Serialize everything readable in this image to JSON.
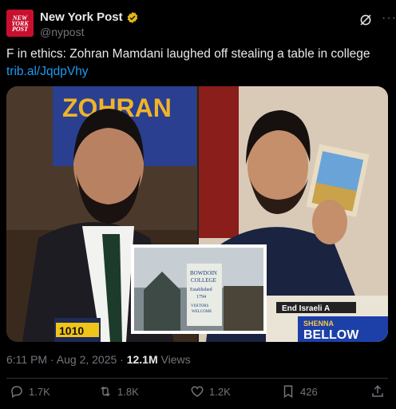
{
  "account": {
    "name": "New York Post",
    "handle": "@nypost",
    "logo_lines": [
      "NEW",
      "YORK",
      "POST"
    ]
  },
  "tweet": {
    "text": "F in ethics: Zohran Mamdani laughed off stealing a table in college ",
    "link": "trib.al/JqdpVhy",
    "time": "6:11 PM · Aug 2, 2025 · ",
    "views_count": "12.1M",
    "views_label": " Views"
  },
  "media": {
    "sign_left": "ZOHRAN",
    "mic_flag": "1010",
    "college_sign_lines": [
      "BOWDOIN",
      "COLLEGE",
      "Established",
      "1794",
      "VISITORS",
      "WELCOME"
    ],
    "table_sign_1": "End Israeli A",
    "table_sign_2": "SHENNA",
    "table_sign_3": "BELLOW"
  },
  "actions": {
    "replies": "1.7K",
    "reposts": "1.8K",
    "likes": "1.2K",
    "bookmarks": "426"
  },
  "colors": {
    "accent": "#1d9bf0",
    "brand": "#c8102e",
    "verified": "#e2b719"
  }
}
